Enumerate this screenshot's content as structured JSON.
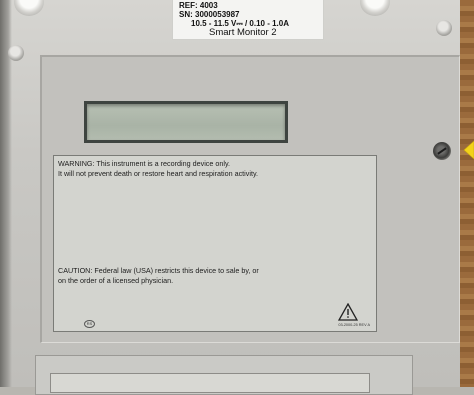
{
  "device_label": {
    "ref": "REF: 4003",
    "serial": "SN: 3000053987",
    "power": "10.5 - 11.5 V⎓ / 0.10 - 1.0A",
    "model": "Smart Monitor 2"
  },
  "warning_label": {
    "warning_line1": "WARNING:  This instrument is a recording device only.",
    "warning_line2": "It will not prevent death or restore heart and respiration activity.",
    "caution_line1": "CAUTION:  Federal law (USA) restricts this device to sale by, or",
    "caution_line2": "on the order of a licensed physician.",
    "part_number": "03-2000-25 REV A",
    "logo_text": "RS"
  },
  "icons": {
    "caution_symbol": "warning-triangle-icon",
    "marker": "yellow-arrow-icon"
  },
  "colors": {
    "marker_yellow": "#f2d21b",
    "lcd_green": "#aab4a6"
  }
}
